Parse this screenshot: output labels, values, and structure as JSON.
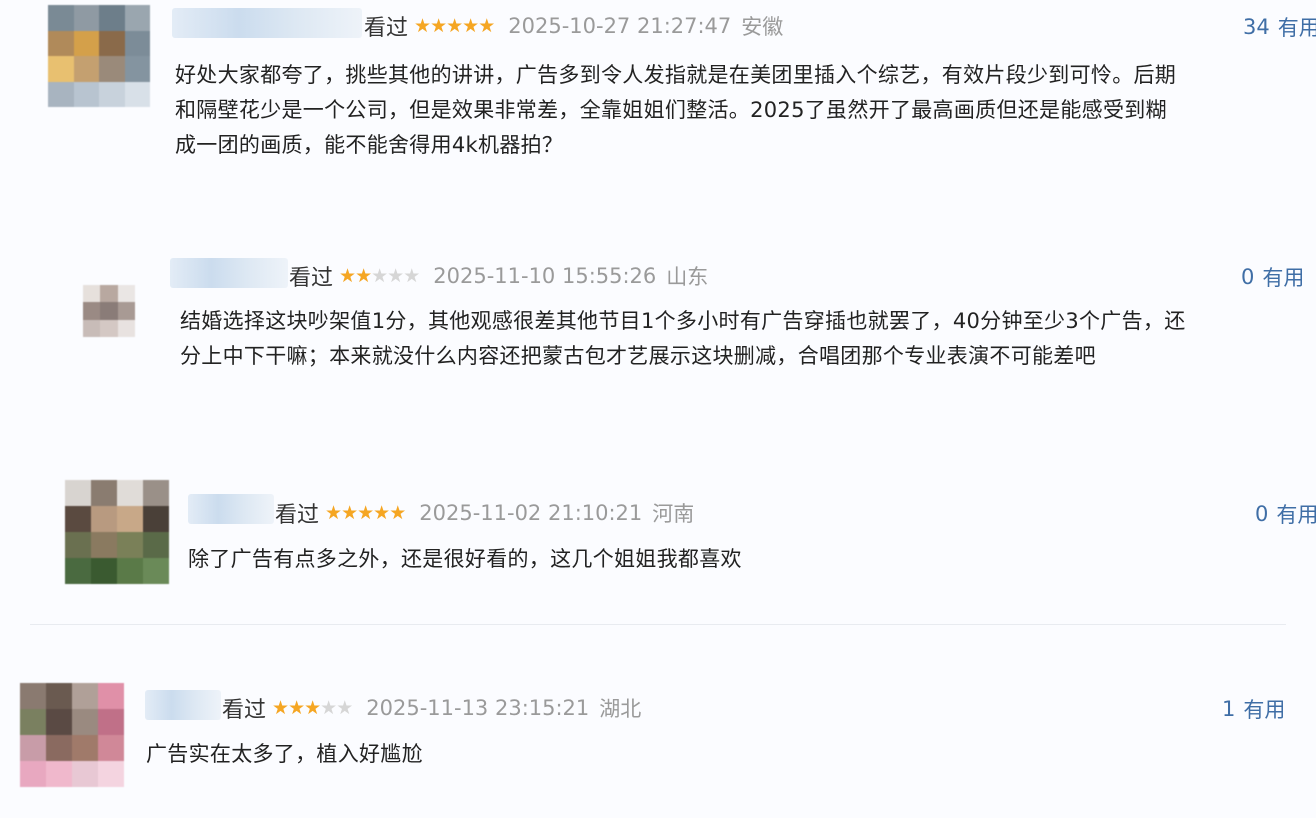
{
  "reviews": [
    {
      "watched": "看过",
      "rating": 5,
      "time": "2025-10-27 21:27:47",
      "region": "安徽",
      "useful_count": "34",
      "useful_label": "有用",
      "lines": [
        "好处大家都夸了，挑些其他的讲讲，广告多到令人发指就是在美团里插入个综艺，有效片段少到可怜。后期",
        "和隔壁花少是一个公司，但是效果非常差，全靠姐姐们整活。2025了虽然开了最高画质但还是能感受到糊",
        "成一团的画质，能不能舍得用4k机器拍？"
      ]
    },
    {
      "watched": "看过",
      "rating": 2,
      "time": "2025-11-10 15:55:26",
      "region": "山东",
      "useful_count": "0",
      "useful_label": "有用",
      "lines": [
        "结婚选择这块吵架值1分，其他观感很差其他节目1个多小时有广告穿插也就罢了，40分钟至少3个广告，还",
        "分上中下干嘛；本来就没什么内容还把蒙古包才艺展示这块删减，合唱团那个专业表演不可能差吧"
      ]
    },
    {
      "watched": "看过",
      "rating": 5,
      "time": "2025-11-02 21:10:21",
      "region": "河南",
      "useful_count": "0",
      "useful_label": "有用",
      "lines": [
        "除了广告有点多之外，还是很好看的，这几个姐姐我都喜欢"
      ]
    },
    {
      "watched": "看过",
      "rating": 3,
      "time": "2025-11-13 23:15:21",
      "region": "湖北",
      "useful_count": "1",
      "useful_label": "有用",
      "lines": [
        "广告实在太多了，植入好尴尬"
      ]
    }
  ],
  "colors": {
    "star_on": "#f5a623",
    "star_off": "#d6d6d6",
    "useful": "#3f6ea6",
    "meta_gray": "#9a9a9a"
  }
}
